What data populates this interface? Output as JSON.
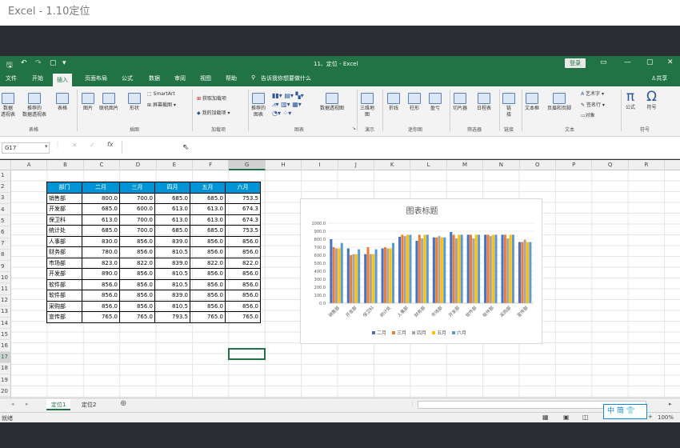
{
  "window": {
    "video_title": "Excel - 1.10定位",
    "doc_title": "11、定位 - Excel",
    "login_label": "登录",
    "share_label": "共享"
  },
  "quick_access": {
    "save_icon": "save-icon",
    "undo_icon": "undo-icon",
    "redo_icon": "redo-icon",
    "new_icon": "new-file-icon"
  },
  "tabs": [
    "文件",
    "开始",
    "插入",
    "页面布局",
    "公式",
    "数据",
    "审阅",
    "视图",
    "帮助"
  ],
  "active_tab": "插入",
  "search_placeholder": "告诉我你想要做什么",
  "ribbon": {
    "tables": {
      "pivot1": "数据",
      "pivot2": "透视表",
      "rec1": "推荐的",
      "rec2": "数据透视表",
      "table": "表格",
      "group": "表格"
    },
    "illustrations": {
      "picture": "图片",
      "online_picture": "联机图片",
      "shapes": "形状",
      "smartart": "SmartArt",
      "screenshot": "屏幕截图",
      "group": "插图"
    },
    "addins": {
      "get": "获取加载项",
      "my": "我的加载项",
      "group": "加载项"
    },
    "charts": {
      "rec1": "推荐的",
      "rec2": "图表",
      "pivotchart": "数据透视图",
      "group": "图表"
    },
    "tours": {
      "map3d_1": "三维地",
      "map3d_2": "图",
      "group": "演示"
    },
    "sparklines": {
      "line": "折线",
      "column": "柱形",
      "winloss": "盈亏",
      "group": "迷你图"
    },
    "filters": {
      "slicer": "切片器",
      "timeline": "日程表",
      "group": "筛选器"
    },
    "links": {
      "link1": "链",
      "link2": "接",
      "group": "链接"
    },
    "text": {
      "textbox": "文本框",
      "headerfooter": "页眉和页脚",
      "wordart": "艺术字",
      "signature": "签名行",
      "object": "对象",
      "group": "文本"
    },
    "symbols": {
      "equation": "公式",
      "symbol": "符号",
      "group": "符号"
    }
  },
  "formula_bar": {
    "name_box": "G17",
    "formula": ""
  },
  "columns": [
    "A",
    "B",
    "C",
    "D",
    "E",
    "F",
    "G",
    "H",
    "I",
    "J",
    "K",
    "L",
    "M",
    "N",
    "O",
    "P",
    "Q",
    "R"
  ],
  "rows": [
    "1",
    "2",
    "3",
    "4",
    "5",
    "6",
    "7",
    "8",
    "9",
    "10",
    "11",
    "12",
    "13",
    "14",
    "15",
    "16",
    "17",
    "18",
    "19",
    "20"
  ],
  "table": {
    "headers": [
      "部门",
      "二月",
      "三月",
      "四月",
      "五月",
      "六月"
    ],
    "rows": [
      [
        "销售部",
        "800.0",
        "700.0",
        "685.0",
        "685.0",
        "753.5"
      ],
      [
        "开发部",
        "685.0",
        "600.0",
        "613.0",
        "613.0",
        "674.3"
      ],
      [
        "保卫科",
        "613.0",
        "700.0",
        "613.0",
        "613.0",
        "674.3"
      ],
      [
        "统计处",
        "685.0",
        "700.0",
        "685.0",
        "685.0",
        "753.5"
      ],
      [
        "人事部",
        "830.0",
        "856.0",
        "839.0",
        "856.0",
        "856.0"
      ],
      [
        "财务部",
        "780.0",
        "856.0",
        "810.5",
        "856.0",
        "856.0"
      ],
      [
        "市场部",
        "823.0",
        "822.0",
        "839.0",
        "822.0",
        "822.0"
      ],
      [
        "开发部",
        "890.0",
        "856.0",
        "810.5",
        "856.0",
        "856.0"
      ],
      [
        "软件部",
        "856.0",
        "856.0",
        "810.5",
        "856.0",
        "856.0"
      ],
      [
        "软件部",
        "856.0",
        "856.0",
        "839.0",
        "856.0",
        "856.0"
      ],
      [
        "采购部",
        "856.0",
        "856.0",
        "810.5",
        "856.0",
        "856.0"
      ],
      [
        "宣传部",
        "765.0",
        "765.0",
        "793.5",
        "765.0",
        "765.0"
      ]
    ]
  },
  "chart_data": {
    "type": "bar",
    "title": "图表标题",
    "categories": [
      "销售部",
      "开发部",
      "保卫科",
      "统计处",
      "人事部",
      "财务部",
      "市场部",
      "开发部",
      "软件部",
      "软件部",
      "采购部",
      "宣传部"
    ],
    "series": [
      {
        "name": "二月",
        "color": "#4472c4",
        "values": [
          800,
          685,
          613,
          685,
          830,
          780,
          823,
          890,
          856,
          856,
          856,
          765
        ]
      },
      {
        "name": "三月",
        "color": "#ed7d31",
        "values": [
          700,
          600,
          700,
          700,
          856,
          856,
          822,
          856,
          856,
          856,
          856,
          765
        ]
      },
      {
        "name": "四月",
        "color": "#a5a5a5",
        "values": [
          685,
          613,
          613,
          685,
          839,
          810.5,
          839,
          810.5,
          810.5,
          839,
          810.5,
          793.5
        ]
      },
      {
        "name": "五月",
        "color": "#ffc000",
        "values": [
          685,
          613,
          613,
          685,
          856,
          856,
          822,
          856,
          856,
          856,
          856,
          765
        ]
      },
      {
        "name": "六月",
        "color": "#5b9bd5",
        "values": [
          753.5,
          674.3,
          674.3,
          753.5,
          856,
          856,
          822,
          856,
          856,
          856,
          856,
          765
        ]
      }
    ],
    "yticks": [
      "0.0",
      "100.0",
      "200.0",
      "300.0",
      "400.0",
      "500.0",
      "600.0",
      "700.0",
      "800.0",
      "900.0",
      "1000.0"
    ],
    "ylim": [
      0,
      1000
    ],
    "grid": true,
    "legend": "bottom"
  },
  "sheets": [
    "定位1",
    "定位2"
  ],
  "active_sheet": "定位1",
  "status": {
    "ready": "就绪",
    "zoom": "100%"
  },
  "ime": {
    "label": "中 简"
  }
}
